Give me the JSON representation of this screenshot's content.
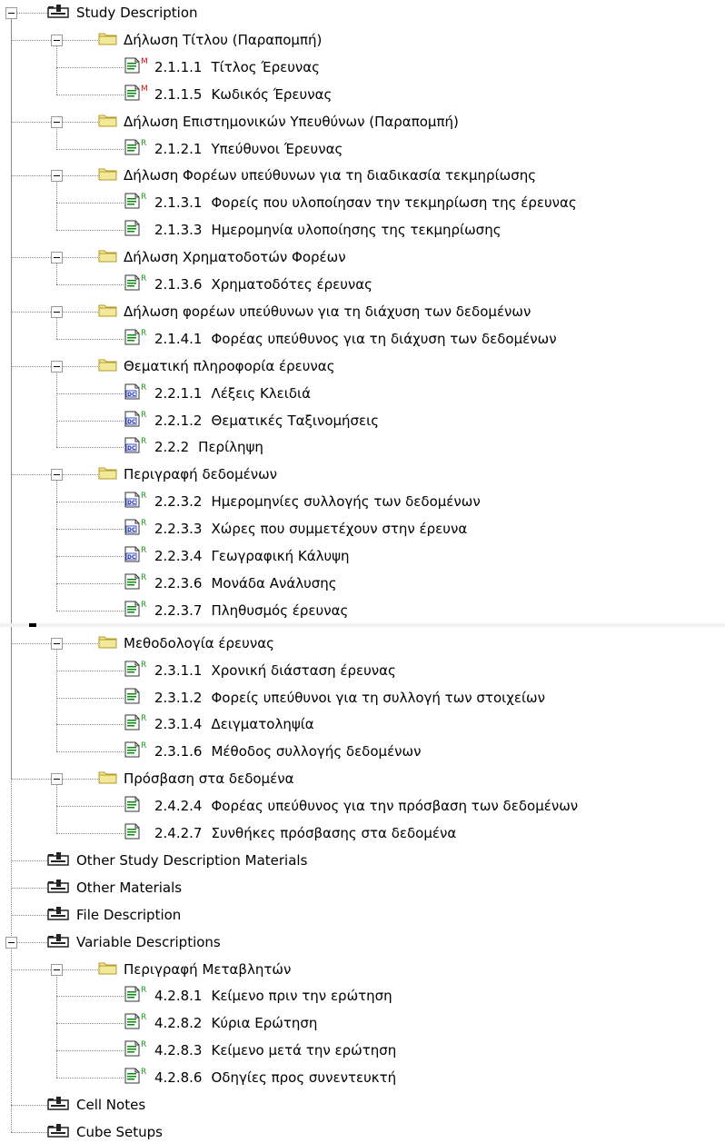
{
  "colors": {
    "folder_fill": "#f2e89a",
    "folder_edge": "#b59a2a",
    "doc_green": "#0a8a0a",
    "letter_M": "#d01010",
    "letter_R": "#1a9a1a",
    "tree_line": "#8a8a8a"
  },
  "tree": [
    {
      "label": "Study Description",
      "icon": "section-icon",
      "expanded": true,
      "children": [
        {
          "label": "Δήλωση Τίτλου (Παραπομπή)",
          "icon": "folder-icon",
          "expanded": true,
          "children": [
            {
              "num": "2.1.1.1",
              "text": "Τίτλος Έρευνας",
              "icon": "document-icon",
              "badge": "M"
            },
            {
              "num": "2.1.1.5",
              "text": "Κωδικός Έρευνας",
              "icon": "document-icon",
              "badge": "M"
            }
          ]
        },
        {
          "label": "Δήλωση Επιστημονικών Υπευθύνων (Παραπομπή)",
          "icon": "folder-icon",
          "expanded": true,
          "children": [
            {
              "num": "2.1.2.1",
              "text": "Υπεύθυνοι Έρευνας",
              "icon": "document-icon",
              "badge": "R"
            }
          ]
        },
        {
          "label": "Δήλωση Φορέων υπεύθυνων για τη διαδικασία τεκμηρίωσης",
          "icon": "folder-icon",
          "expanded": true,
          "children": [
            {
              "num": "2.1.3.1",
              "text": "Φορείς που υλοποίησαν την τεκμηρίωση της έρευνας",
              "icon": "document-icon",
              "badge": "R"
            },
            {
              "num": "2.1.3.3",
              "text": "Ημερομηνία υλοποίησης της τεκμηρίωσης",
              "icon": "document-icon",
              "badge": ""
            }
          ]
        },
        {
          "label": "Δήλωση Χρηματοδοτών Φορέων",
          "icon": "folder-icon",
          "expanded": true,
          "children": [
            {
              "num": "2.1.3.6",
              "text": "Χρηματοδότες έρευνας",
              "icon": "document-icon",
              "badge": "R"
            }
          ]
        },
        {
          "label": "Δήλωση φορέων υπεύθυνων για τη διάχυση των δεδομένων",
          "icon": "folder-icon",
          "expanded": true,
          "children": [
            {
              "num": "2.1.4.1",
              "text": "Φορέας υπεύθυνος για τη διάχυση των δεδομένων",
              "icon": "document-icon",
              "badge": "R"
            }
          ]
        },
        {
          "label": "Θεματική πληροφορία έρευνας",
          "icon": "folder-icon",
          "expanded": true,
          "children": [
            {
              "num": "2.2.1.1",
              "text": "Λέξεις Κλειδιά",
              "icon": "dc-document-icon",
              "badge": "R"
            },
            {
              "num": "2.2.1.2",
              "text": "Θεματικές Ταξινομήσεις",
              "icon": "dc-document-icon",
              "badge": "R"
            },
            {
              "num": "2.2.2",
              "text": "Περίληψη",
              "icon": "dc-document-icon",
              "badge": "R"
            }
          ]
        },
        {
          "label": "Περιγραφή δεδομένων",
          "icon": "folder-icon",
          "expanded": true,
          "children": [
            {
              "num": "2.2.3.2",
              "text": "Ημερομηνίες συλλογής των δεδομένων",
              "icon": "dc-document-icon",
              "badge": "R"
            },
            {
              "num": "2.2.3.3",
              "text": "Χώρες που συμμετέχουν στην έρευνα",
              "icon": "dc-document-icon",
              "badge": "R"
            },
            {
              "num": "2.2.3.4",
              "text": "Γεωγραφική Κάλυψη",
              "icon": "dc-document-icon",
              "badge": "R"
            },
            {
              "num": "2.2.3.6",
              "text": "Μονάδα Ανάλυσης",
              "icon": "document-icon",
              "badge": "R"
            },
            {
              "num": "2.2.3.7",
              "text": "Πληθυσμός έρευνας",
              "icon": "document-icon",
              "badge": "R"
            }
          ]
        },
        {
          "label": "Μεθοδολογία έρευνας",
          "icon": "folder-icon",
          "expanded": true,
          "children": [
            {
              "num": "2.3.1.1",
              "text": "Χρονική διάσταση έρευνας",
              "icon": "document-icon",
              "badge": "R"
            },
            {
              "num": "2.3.1.2",
              "text": "Φορείς υπεύθυνοι για τη συλλογή των στοιχείων",
              "icon": "document-icon",
              "badge": ""
            },
            {
              "num": "2.3.1.4",
              "text": "Δειγματοληψία",
              "icon": "document-icon",
              "badge": "R"
            },
            {
              "num": "2.3.1.6",
              "text": "Μέθοδος συλλογής δεδομένων",
              "icon": "document-icon",
              "badge": "R"
            }
          ]
        },
        {
          "label": "Πρόσβαση στα δεδομένα",
          "icon": "folder-icon",
          "expanded": true,
          "children": [
            {
              "num": "2.4.2.4",
              "text": "Φορέας υπεύθυνος για την πρόσβαση των δεδομένων",
              "icon": "document-icon",
              "badge": ""
            },
            {
              "num": "2.4.2.7",
              "text": "Συνθήκες πρόσβασης στα δεδομένα",
              "icon": "document-icon",
              "badge": ""
            }
          ]
        }
      ]
    },
    {
      "label": "Other Study Description Materials",
      "icon": "section-icon",
      "expanded": false,
      "children": []
    },
    {
      "label": "Other Materials",
      "icon": "section-icon",
      "expanded": false,
      "children": []
    },
    {
      "label": "File Description",
      "icon": "section-icon",
      "expanded": false,
      "children": []
    },
    {
      "label": "Variable Descriptions",
      "icon": "section-icon",
      "expanded": true,
      "children": [
        {
          "label": "Περιγραφή Μεταβλητών",
          "icon": "folder-icon",
          "expanded": true,
          "children": [
            {
              "num": "4.2.8.1",
              "text": "Κείμενο πριν την ερώτηση",
              "icon": "document-icon",
              "badge": "R"
            },
            {
              "num": "4.2.8.2",
              "text": "Κύρια Ερώτηση",
              "icon": "document-icon",
              "badge": "R"
            },
            {
              "num": "4.2.8.3",
              "text": "Κείμενο μετά την ερώτηση",
              "icon": "document-icon",
              "badge": "R"
            },
            {
              "num": "4.2.8.6",
              "text": "Οδηγίες προς συνεντευκτή",
              "icon": "document-icon",
              "badge": "R"
            }
          ]
        }
      ]
    },
    {
      "label": "Cell Notes",
      "icon": "section-icon",
      "expanded": false,
      "children": []
    },
    {
      "label": "Cube Setups",
      "icon": "section-icon",
      "expanded": false,
      "children": []
    }
  ]
}
